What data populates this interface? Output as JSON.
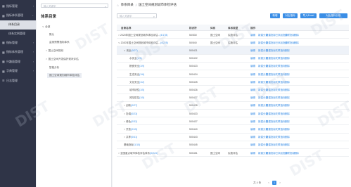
{
  "sidebar": {
    "items": [
      {
        "label": "指标管理",
        "icon": "grid-icon"
      },
      {
        "label": "指标体系管理",
        "icon": "grid-icon"
      },
      {
        "label": "体系目录",
        "sub": true,
        "active": true
      },
      {
        "label": "体系实例管理",
        "sub": true
      },
      {
        "label": "指标管理",
        "icon": "grid-icon"
      },
      {
        "label": "指标体系管理",
        "icon": "grid-icon"
      },
      {
        "label": "兴趣面管理",
        "icon": "grid-icon"
      },
      {
        "label": "字典管理",
        "icon": "grid-icon"
      },
      {
        "label": "日志管理",
        "icon": "list-icon"
      }
    ]
  },
  "tree": {
    "search_placeholder": "输入关键字",
    "title": "体系目录",
    "nodes": [
      {
        "label": "全部",
        "caret": "∨"
      },
      {
        "label": "默认",
        "caret": ""
      },
      {
        "label": "监测预警指标体系",
        "caret": ""
      },
      {
        "label": "国土空间规划",
        "caret": ">"
      },
      {
        "label": "国土空间开发保护现状评估",
        "caret": ">"
      },
      {
        "label": "智能分析",
        "caret": ""
      },
      {
        "label": "国土空间规划城市体检评估",
        "caret": "",
        "selected": true
      }
    ]
  },
  "breadcrumb": {
    "section": "体系目录",
    "current": "国土空间规划城市体检评估"
  },
  "search": {
    "placeholder": "输入关键字"
  },
  "buttons": {
    "add": "新增",
    "edit_copy": "对比指标",
    "import_excel": "导入Excel",
    "batch_edit": "对比指标分析"
  },
  "table": {
    "headers": [
      "目录名称",
      "标识符",
      "体系",
      "体系类型",
      "操作"
    ],
    "actions": [
      "编辑",
      "新建分类",
      "新建指标",
      "已添加指标",
      "关联指标",
      "删除"
    ],
    "rows": [
      {
        "name": "2020年国土空间规划城市体检评估...",
        "count": "(4/178)",
        "caret": ">",
        "indent": 0,
        "id": "50/530",
        "sys": "国土空间",
        "type": "实施评估",
        "acts": 6
      },
      {
        "name": "2020年国土空间规划城市体检评估...",
        "count": "(4/225)",
        "caret": "∨",
        "indent": 0,
        "id": "50/540",
        "sys": "国土空间",
        "type": "实施评估",
        "acts": 6
      },
      {
        "name": "安全",
        "count": "(0/27)",
        "caret": "∨",
        "indent": 1,
        "id": "500421",
        "sys": "",
        "type": "",
        "acts": 5,
        "hl": true
      },
      {
        "name": "水安全",
        "count": "(1/5)",
        "caret": "",
        "indent": 2,
        "id": "500422",
        "sys": "",
        "type": "",
        "acts": 5
      },
      {
        "name": "粮食安全",
        "count": "(1/9)",
        "caret": "",
        "indent": 2,
        "id": "500423",
        "sys": "",
        "type": "",
        "acts": 5
      },
      {
        "name": "生态安全",
        "count": "(1/6)",
        "caret": "",
        "indent": 2,
        "id": "500424",
        "sys": "",
        "type": "",
        "acts": 5
      },
      {
        "name": "文化安全",
        "count": "(1/2)",
        "caret": "",
        "indent": 2,
        "id": "500425",
        "sys": "",
        "type": "",
        "acts": 5
      },
      {
        "name": "城市韧性",
        "count": "(1/5)",
        "caret": "",
        "indent": 2,
        "id": "500426",
        "sys": "",
        "type": "",
        "acts": 5
      },
      {
        "name": "风险防控",
        "count": "(1/5)",
        "caret": "",
        "indent": 2,
        "id": "500427",
        "sys": "",
        "type": "",
        "acts": 5
      },
      {
        "name": "创新",
        "count": "(0/27)",
        "caret": ">",
        "indent": 1,
        "id": "500428",
        "sys": "",
        "type": "",
        "acts": 5
      },
      {
        "name": "协调",
        "count": "(0/23)",
        "caret": ">",
        "indent": 1,
        "id": "500433",
        "sys": "",
        "type": "",
        "acts": 5
      },
      {
        "name": "绿色",
        "count": "(0/32)",
        "caret": ">",
        "indent": 1,
        "id": "500437",
        "sys": "",
        "type": "",
        "acts": 5
      },
      {
        "name": "开放",
        "count": "(0/15)",
        "caret": ">",
        "indent": 1,
        "id": "500440",
        "sys": "",
        "type": "",
        "acts": 5
      },
      {
        "name": "共享",
        "count": "(0/41)",
        "caret": ">",
        "indent": 1,
        "id": "500443",
        "sys": "",
        "type": "",
        "acts": 5
      },
      {
        "name": "基础指标",
        "count": "(1/10)",
        "caret": "",
        "indent": 1,
        "id": "500445",
        "sys": "",
        "type": "",
        "acts": 5
      },
      {
        "name": "全国重点城市体检评估体系",
        "count": "(0/224)",
        "caret": ">",
        "indent": 0,
        "id": "500451",
        "sys": "国土空间",
        "type": "实施评估",
        "acts": 6
      }
    ]
  },
  "pagination": {
    "total": "共 4 条",
    "prev": "<",
    "page": "1",
    "next": ">"
  },
  "watermark": "DIST"
}
